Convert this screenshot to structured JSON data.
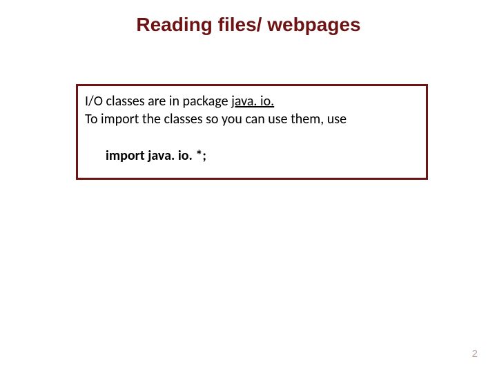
{
  "title": "Reading files/ webpages",
  "box": {
    "line1_prefix": "I/O classes are in package ",
    "line1_pkg": "java. io.",
    "line2": "To import the classes so you can use them, use",
    "code": "import java. io. *;"
  },
  "page_number": "2"
}
